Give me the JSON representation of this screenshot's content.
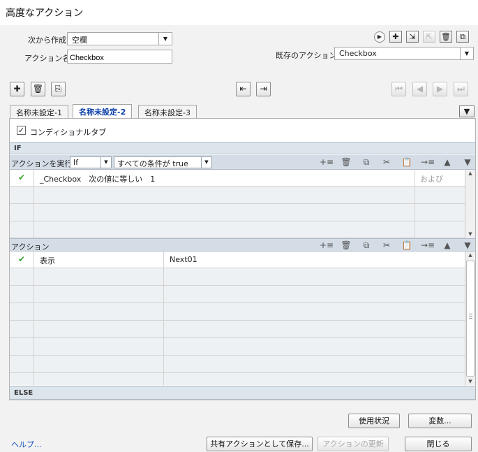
{
  "window": {
    "title": "高度なアクション"
  },
  "top_form": {
    "create_from_label": "次から作成:",
    "create_from_value": "空欄",
    "action_name_label": "アクション名:",
    "action_name_value": "Checkbox",
    "existing_label": "既存のアクション:",
    "existing_value": "Checkbox"
  },
  "tabs": [
    {
      "label": "名称未設定-1"
    },
    {
      "label": "名称未設定-2"
    },
    {
      "label": "名称未設定-3"
    }
  ],
  "conditional_tab_label": "コンディショナルタブ",
  "conditional_tab_checked": true,
  "if_section": {
    "header": "IF",
    "run_action_label": "アクションを実行:",
    "run_action_value": "If",
    "condition_value": "すべての条件が true",
    "rows": [
      {
        "expression": "_Checkbox　次の値に等しい　1",
        "join": "および",
        "checked": true
      }
    ]
  },
  "action_section": {
    "header": "アクション",
    "rows": [
      {
        "action": "表示",
        "target": "Next01",
        "checked": true
      }
    ]
  },
  "else_header": "ELSE",
  "buttons": {
    "usage": "使用状況",
    "variables": "変数...",
    "help": "ヘルプ...",
    "save_shared": "共有アクションとして保存...",
    "update_action": "アクションの更新",
    "close": "閉じる"
  },
  "colors": {
    "accent_tab": "#0a3ea8",
    "check": "#37a22c",
    "section_bg": "#dce4ec"
  }
}
